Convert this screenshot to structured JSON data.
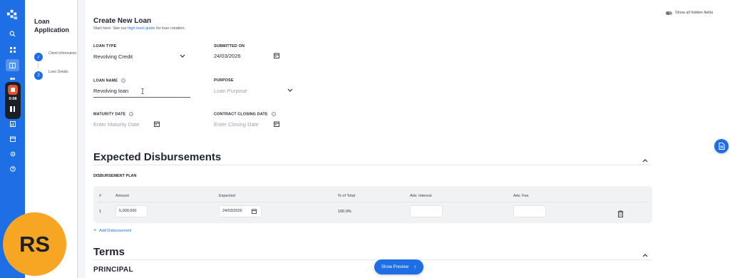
{
  "colors": {
    "accent": "#1e6fe6",
    "recorder_stop": "#e5502e",
    "avatar_bg": "#f6a623"
  },
  "recorder": {
    "time": "0:08"
  },
  "sidebar_icons": [
    "search-icon",
    "grid-icon",
    "book-icon",
    "users-icon",
    "chart-icon",
    "calendar-icon",
    "settings-icon",
    "help-icon"
  ],
  "steps_panel": {
    "title": "Loan Application",
    "steps": [
      {
        "number": "✓",
        "label": "Client Information",
        "state": "completed"
      },
      {
        "number": "2",
        "label": "Loan Details",
        "state": "current"
      }
    ]
  },
  "header": {
    "title": "Create New Loan",
    "subtitle_prefix": "Start here: See our",
    "subtitle_link": "high-level guide",
    "subtitle_suffix": "for loan creation.",
    "toggle_label": "Show all hidden fields"
  },
  "form": {
    "loan_type": {
      "label": "LOAN TYPE",
      "value": "Revolving Credit"
    },
    "submitted_on": {
      "label": "SUBMITTED ON",
      "value": "24/03/2026"
    },
    "loan_name": {
      "label": "LOAN NAME",
      "value": "Revolving loan"
    },
    "purpose": {
      "label": "PURPOSE",
      "placeholder": "Loan Purpose"
    },
    "maturity_date": {
      "label": "MATURITY DATE",
      "placeholder": "Enter Maturity Date"
    },
    "contract_closing_date": {
      "label": "CONTRACT CLOSING DATE",
      "placeholder": "Enter Closing Date"
    }
  },
  "disbursements": {
    "title": "Expected Disbursements",
    "plan_label": "DISBURSEMENT PLAN",
    "columns": [
      "#",
      "Amount",
      "Expected",
      "% of Total",
      "Adv. Interest",
      "Adv. Fee"
    ],
    "rows": [
      {
        "index": "1",
        "amount": "5,000,000",
        "expected": "24/03/2026",
        "percent": "100.0%",
        "adv_interest": "",
        "adv_fee": ""
      }
    ],
    "add_label": "Add Disbursement"
  },
  "terms": {
    "title": "Terms",
    "principal_label": "PRINCIPAL"
  },
  "preview_button": "Show Preview",
  "avatar_initials": "RS"
}
